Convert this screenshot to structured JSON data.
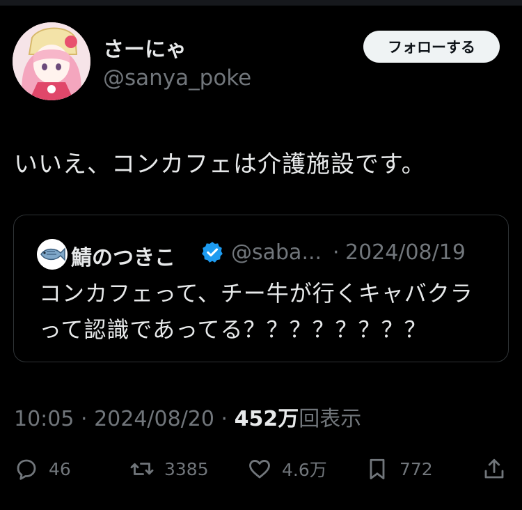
{
  "user": {
    "name": "さーにゃ",
    "handle": "@sanya_poke",
    "avatar_icon": "anime-avatar-icon"
  },
  "follow_label": "フォローする",
  "tweet_text": "いいえ、コンカフェは介護施設です。",
  "quote": {
    "name": "鯖のつきこ",
    "handle": "@saba...",
    "separator": "·",
    "date": "2024/08/19",
    "text": "コンカフェって、チー牛が行くキャバクラって認識であってる？？？？？？？？",
    "icon": "fish-icon",
    "verified_icon": "verified-badge-icon"
  },
  "meta": {
    "time": "10:05 · 2024/08/20 · ",
    "views": "452万",
    "views_label": "回表示"
  },
  "actions": {
    "reply": "46",
    "retweet": "3385",
    "like": "4.6万",
    "bookmark": "772"
  },
  "colors": {
    "background": "#000000",
    "text": "#e7e9ea",
    "secondary": "#71767b",
    "border": "#2f3336",
    "verified": "#1d9bf0"
  }
}
